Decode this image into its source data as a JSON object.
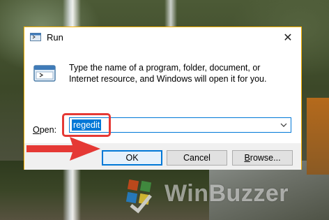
{
  "dialog": {
    "title": "Run",
    "description": "Type the name of a program, folder, document, or Internet resource, and Windows will open it for you.",
    "open_label_pre": "",
    "open_label_mnemonic": "O",
    "open_label_post": "pen:",
    "open_value": "regedit",
    "close_glyph": "✕"
  },
  "buttons": {
    "ok": "OK",
    "cancel": "Cancel",
    "browse_mnemonic": "B",
    "browse_rest": "rowse..."
  },
  "watermark": {
    "text": "WinBuzzer"
  },
  "annotations": {
    "highlight_color": "#e53935",
    "arrow_color": "#e53935"
  },
  "colors": {
    "accent": "#0078d7",
    "window_border": "#ffb300"
  },
  "icons": [
    "run-app-icon",
    "close-icon",
    "run-large-icon",
    "chevron-down-icon",
    "winbuzzer-logo-icon",
    "red-arrow-icon"
  ]
}
